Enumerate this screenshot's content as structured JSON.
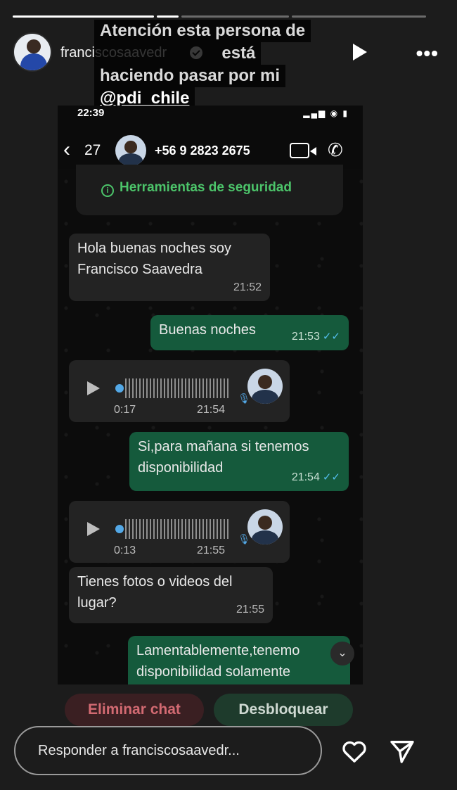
{
  "story": {
    "progress_segments": 4,
    "username": "franciscosaavedr",
    "overlay_lines": [
      "Atención esta persona de",
      "                          está",
      "haciendo pasar por mi",
      "@pdi_chile"
    ]
  },
  "whatsapp": {
    "status_time": "22:39",
    "back_count": "27",
    "phone": "+56 9 2823 2675",
    "security_label": "Herramientas de seguridad",
    "messages": [
      {
        "text": "Hola buenas noches soy Francisco Saavedra",
        "time": "21:52"
      },
      {
        "text": "Buenas noches",
        "time": "21:53"
      },
      {
        "text": "Si,para mañana si tenemos disponibilidad",
        "time": "21:54"
      },
      {
        "text": "Tienes fotos o videos del lugar?",
        "time": "21:55"
      },
      {
        "text": "Lamentablemente,tenemo disponibilidad solamente"
      }
    ],
    "voice_notes": [
      {
        "duration": "0:17",
        "time": "21:54"
      },
      {
        "duration": "0:13",
        "time": "21:55"
      }
    ],
    "delete_button": "Eliminar chat",
    "unblock_button": "Desbloquear"
  },
  "reply": {
    "placeholder": "Responder a franciscosaavedr..."
  },
  "colors": {
    "wa_green": "#155a3c",
    "security_green": "#4cc46a",
    "tick_blue": "#53bdeb"
  }
}
